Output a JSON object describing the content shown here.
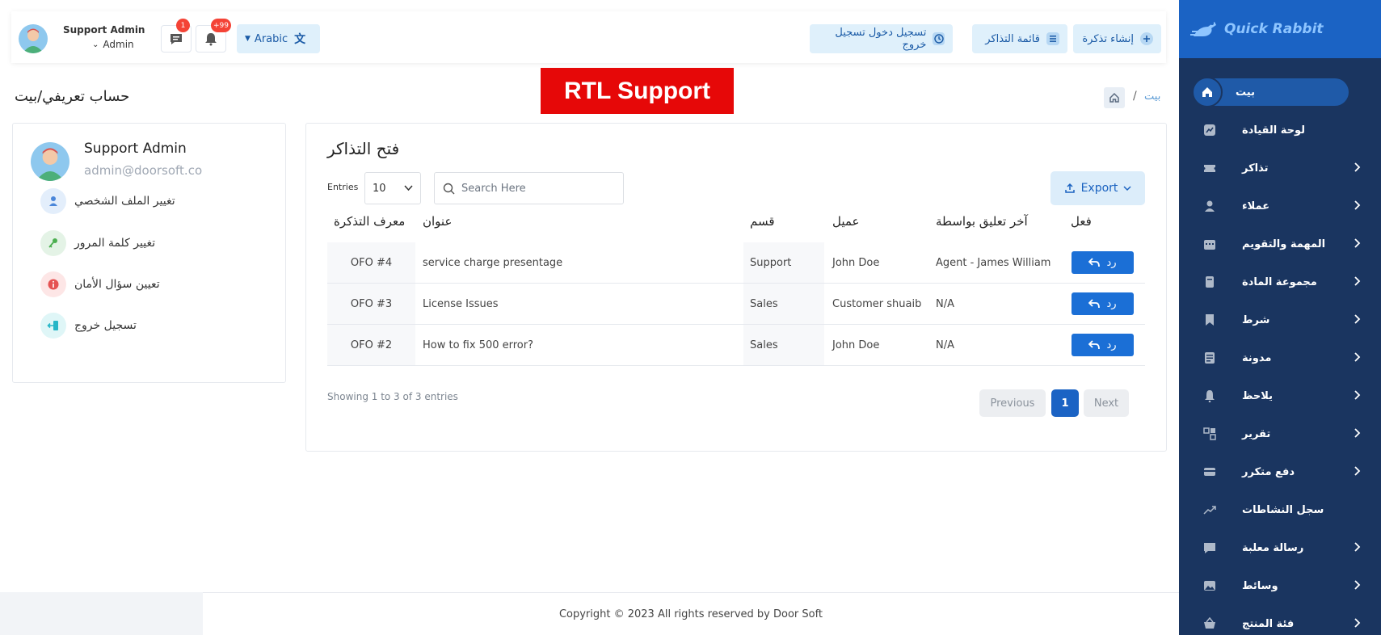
{
  "brand": {
    "name": "Quick Rabbit"
  },
  "sidebar": {
    "items": [
      {
        "label": "بيت",
        "icon": "home-icon"
      },
      {
        "label": "لوحة القيادة",
        "icon": "chart-icon"
      },
      {
        "label": "تذاكر",
        "icon": "ticket-icon"
      },
      {
        "label": "عملاء",
        "icon": "user-icon"
      },
      {
        "label": "المهمة والتقويم",
        "icon": "calendar-icon"
      },
      {
        "label": "مجموعة المادة",
        "icon": "book-icon"
      },
      {
        "label": "شرط",
        "icon": "bookmark-icon"
      },
      {
        "label": "مدونة",
        "icon": "note-icon"
      },
      {
        "label": "يلاحظ",
        "icon": "bell-icon"
      },
      {
        "label": "تقرير",
        "icon": "report-icon"
      },
      {
        "label": "دفع متكرر",
        "icon": "card-icon"
      },
      {
        "label": "سجل النشاطات",
        "icon": "trend-icon"
      },
      {
        "label": "رسالة معلبة",
        "icon": "message-icon"
      },
      {
        "label": "وسائط",
        "icon": "image-icon"
      },
      {
        "label": "فئة المنتج",
        "icon": "basket-icon"
      }
    ]
  },
  "header": {
    "create_ticket": "إنشاء تذكرة",
    "ticket_list": "قائمة التذاكر",
    "check_in_out": "تسجيل دخول تسجيل خروج",
    "language": "Arabic",
    "notifications_count": "+99",
    "messages_count": "1",
    "user_name": "Support Admin",
    "user_role": "Admin"
  },
  "breadcrumb": {
    "current": "بيت",
    "separator": "/"
  },
  "page_title": "حساب تعريفي/بيت",
  "banner": "RTL Support",
  "profile": {
    "name": "Support Admin",
    "email": "admin@doorsoft.co",
    "links": [
      {
        "label": "تغيير الملف الشخصي",
        "icon": "user-icon",
        "color": "#e3eefb",
        "fg": "#4a86d9"
      },
      {
        "label": "تغيير كلمة المرور",
        "icon": "key-icon",
        "color": "#e4f3e6",
        "fg": "#4caf50"
      },
      {
        "label": "تعيين سؤال الأمان",
        "icon": "info-icon",
        "color": "#fde6e6",
        "fg": "#e55353"
      },
      {
        "label": "تسجيل خروج",
        "icon": "logout-icon",
        "color": "#dff6f7",
        "fg": "#26b6c7"
      }
    ]
  },
  "tickets": {
    "title": "فتح التذاكر",
    "entries_label": "Entries",
    "entries_value": "10",
    "search_placeholder": "Search Here",
    "export_label": "Export",
    "columns": {
      "ticket_id": "معرف التذكرة",
      "title": "عنوان",
      "department": "قسم",
      "customer": "عميل",
      "last_comment": "آخر تعليق بواسطة",
      "action": "فعل"
    },
    "rows": [
      {
        "id": "OFO #4",
        "title": "service charge presentage",
        "department": "Support",
        "customer": "John Doe",
        "last_comment": "Agent - James William",
        "action": "رد"
      },
      {
        "id": "OFO #3",
        "title": "License Issues",
        "department": "Sales",
        "customer": "Customer shuaib",
        "last_comment": "N/A",
        "action": "رد"
      },
      {
        "id": "OFO #2",
        "title": "How to fix 500 error?",
        "department": "Sales",
        "customer": "John Doe",
        "last_comment": "N/A",
        "action": "رد"
      }
    ],
    "showing": "Showing 1 to 3 of 3 entries",
    "pagination": {
      "previous": "Previous",
      "page": "1",
      "next": "Next"
    }
  },
  "footer": {
    "copyright": "Copyright © 2023 All rights reserved by Door Soft"
  },
  "colors": {
    "sidebar_bg": "#1a3560",
    "brand_bg": "#1b63c4",
    "accent": "#1b6fd6",
    "banner": "#e60808"
  }
}
